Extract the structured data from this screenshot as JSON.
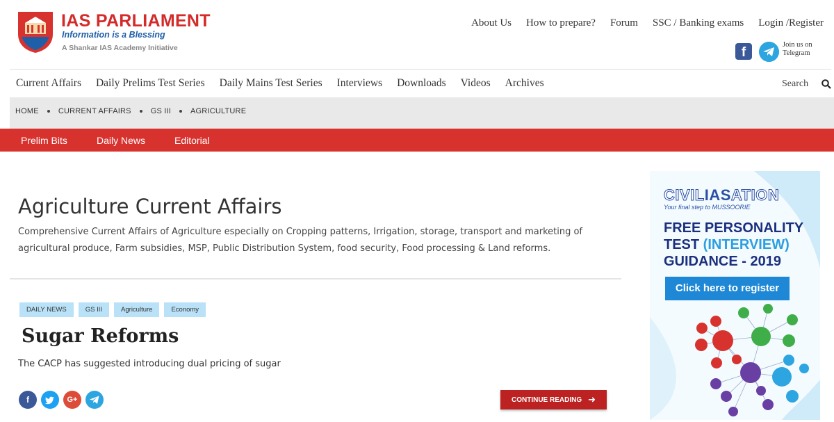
{
  "header": {
    "logo_title": "IAS PARLIAMENT",
    "logo_tagline": "Information is a Blessing",
    "logo_sub": "A Shankar IAS Academy Initiative",
    "top_links": [
      "About Us",
      "How to prepare?",
      "Forum",
      "SSC / Banking exams",
      "Login /Register"
    ],
    "telegram_text": "Join us on Telegram"
  },
  "main_nav": {
    "items": [
      "Current Affairs",
      "Daily Prelims Test Series",
      "Daily Mains Test Series",
      "Interviews",
      "Downloads",
      "Videos",
      "Archives"
    ],
    "search_label": "Search"
  },
  "breadcrumb": [
    "HOME",
    "CURRENT AFFAIRS",
    "GS III",
    "AGRICULTURE"
  ],
  "sub_nav": [
    "Prelim Bits",
    "Daily News",
    "Editorial"
  ],
  "page": {
    "title": "Agriculture Current Affairs",
    "description": "Comprehensive Current Affairs of Agriculture especially on Cropping patterns, Irrigation, storage, transport and marketing of agricultural produce, Farm subsidies, MSP, Public Distribution System, food security, Food processing & Land reforms."
  },
  "article": {
    "tags": [
      "DAILY NEWS",
      "GS III",
      "Agriculture",
      "Economy"
    ],
    "title": "Sugar Reforms",
    "excerpt": "The CACP has suggested introducing dual pricing of sugar",
    "continue_label": "CONTINUE READING",
    "share_glyphs": [
      "f",
      "t",
      "G+"
    ]
  },
  "ad": {
    "logo_civil": "CIVIL",
    "logo_ias": "IAS",
    "logo_ation": "ATION",
    "tagline": "Your final step to MUSSOORIE",
    "heading_1": "FREE PERSONALITY TEST ",
    "heading_hl": "(INTERVIEW)",
    "heading_2": " GUIDANCE - 2019",
    "cta": "Click here to register"
  },
  "colors": {
    "brand_red": "#d8322f",
    "tag_blue": "#b9e1f7",
    "continue_red": "#bc2222",
    "facebook": "#3b5998",
    "twitter": "#1da1f2",
    "google": "#dd4b39",
    "telegram": "#2ca5e0"
  }
}
